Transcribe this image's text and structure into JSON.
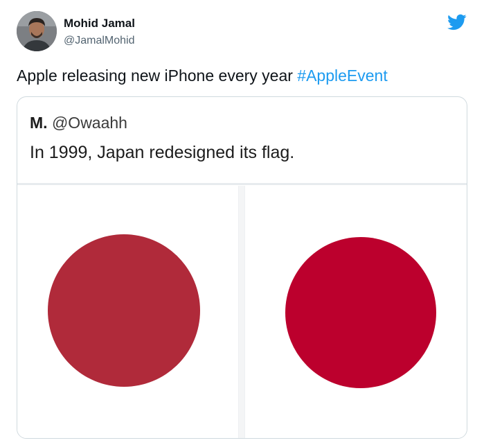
{
  "author": {
    "name": "Mohid Jamal",
    "handle": "@JamalMohid"
  },
  "tweet": {
    "text": "Apple releasing new iPhone every year ",
    "hashtag": "#AppleEvent"
  },
  "quoted": {
    "author_name": "M.",
    "author_handle": "@Owaahh",
    "text": "In 1999, Japan redesigned its flag."
  },
  "flags": {
    "left_disc_color": "#b02a3a",
    "right_disc_color": "#bc002d"
  },
  "colors": {
    "accent": "#1d9bf0",
    "text": "#0f1419",
    "secondary": "#536471"
  },
  "icons": {
    "brand": "twitter-bird-icon"
  }
}
